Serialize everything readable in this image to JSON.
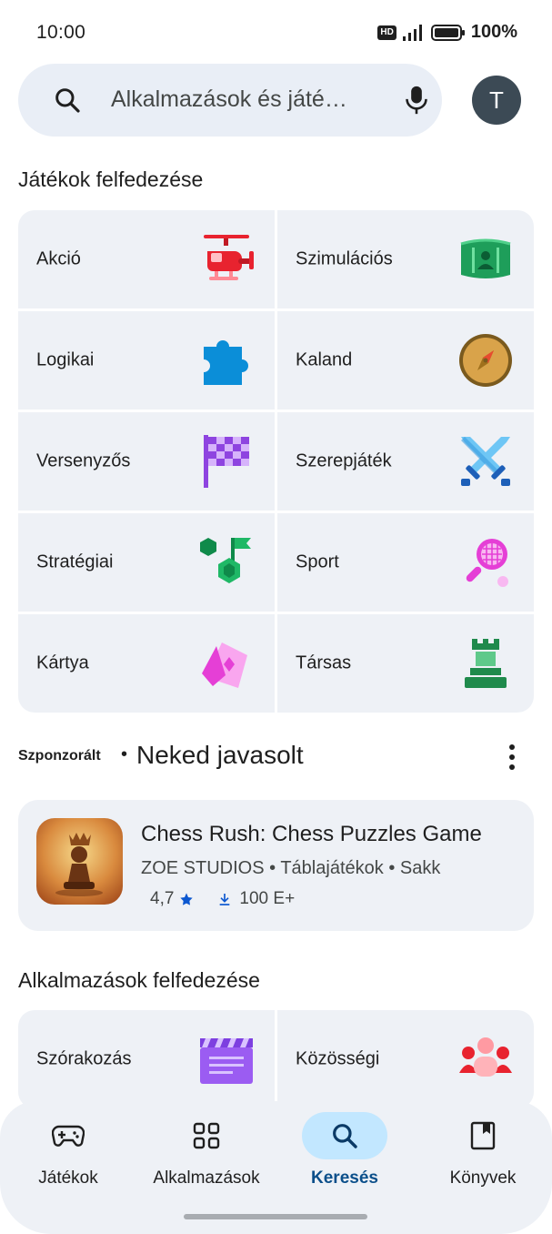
{
  "status_bar": {
    "time": "10:00",
    "hd": "HD",
    "battery": "100%"
  },
  "search": {
    "placeholder": "Alkalmazások és játé…",
    "avatar_letter": "T"
  },
  "games_section": {
    "title": "Játékok felfedezése",
    "categories": [
      {
        "label": "Akció",
        "icon": "helicopter-icon"
      },
      {
        "label": "Szimulációs",
        "icon": "simulation-icon"
      },
      {
        "label": "Logikai",
        "icon": "puzzle-icon"
      },
      {
        "label": "Kaland",
        "icon": "compass-icon"
      },
      {
        "label": "Versenyzős",
        "icon": "checkered-flag-icon"
      },
      {
        "label": "Szerepjáték",
        "icon": "crossed-swords-icon"
      },
      {
        "label": "Stratégiai",
        "icon": "strategy-icon"
      },
      {
        "label": "Sport",
        "icon": "tennis-racket-icon"
      },
      {
        "label": "Kártya",
        "icon": "cards-icon"
      },
      {
        "label": "Társas",
        "icon": "chess-rook-icon"
      }
    ]
  },
  "recommended": {
    "sponsored_label": "Szponzorált",
    "separator": "•",
    "title": "Neked javasolt",
    "app": {
      "name": "Chess Rush: Chess Puzzles Game",
      "developer": "ZOE STUDIOS",
      "category": "Táblajátékok",
      "subcategory": "Sakk",
      "rating": "4,7",
      "downloads": "100 E+"
    }
  },
  "apps_section": {
    "title": "Alkalmazások felfedezése",
    "categories": [
      {
        "label": "Szórakozás",
        "icon": "clapperboard-icon"
      },
      {
        "label": "Közösségi",
        "icon": "people-icon"
      }
    ]
  },
  "bottom_nav": {
    "items": [
      {
        "label": "Játékok",
        "icon": "gamepad-icon",
        "active": false
      },
      {
        "label": "Alkalmazások",
        "icon": "apps-grid-icon",
        "active": false
      },
      {
        "label": "Keresés",
        "icon": "search-icon",
        "active": true
      },
      {
        "label": "Könyvek",
        "icon": "book-icon",
        "active": false
      }
    ]
  },
  "colors": {
    "accent": "#0b57d0",
    "active_pill": "#c2e7ff",
    "surface": "#eef1f6"
  }
}
